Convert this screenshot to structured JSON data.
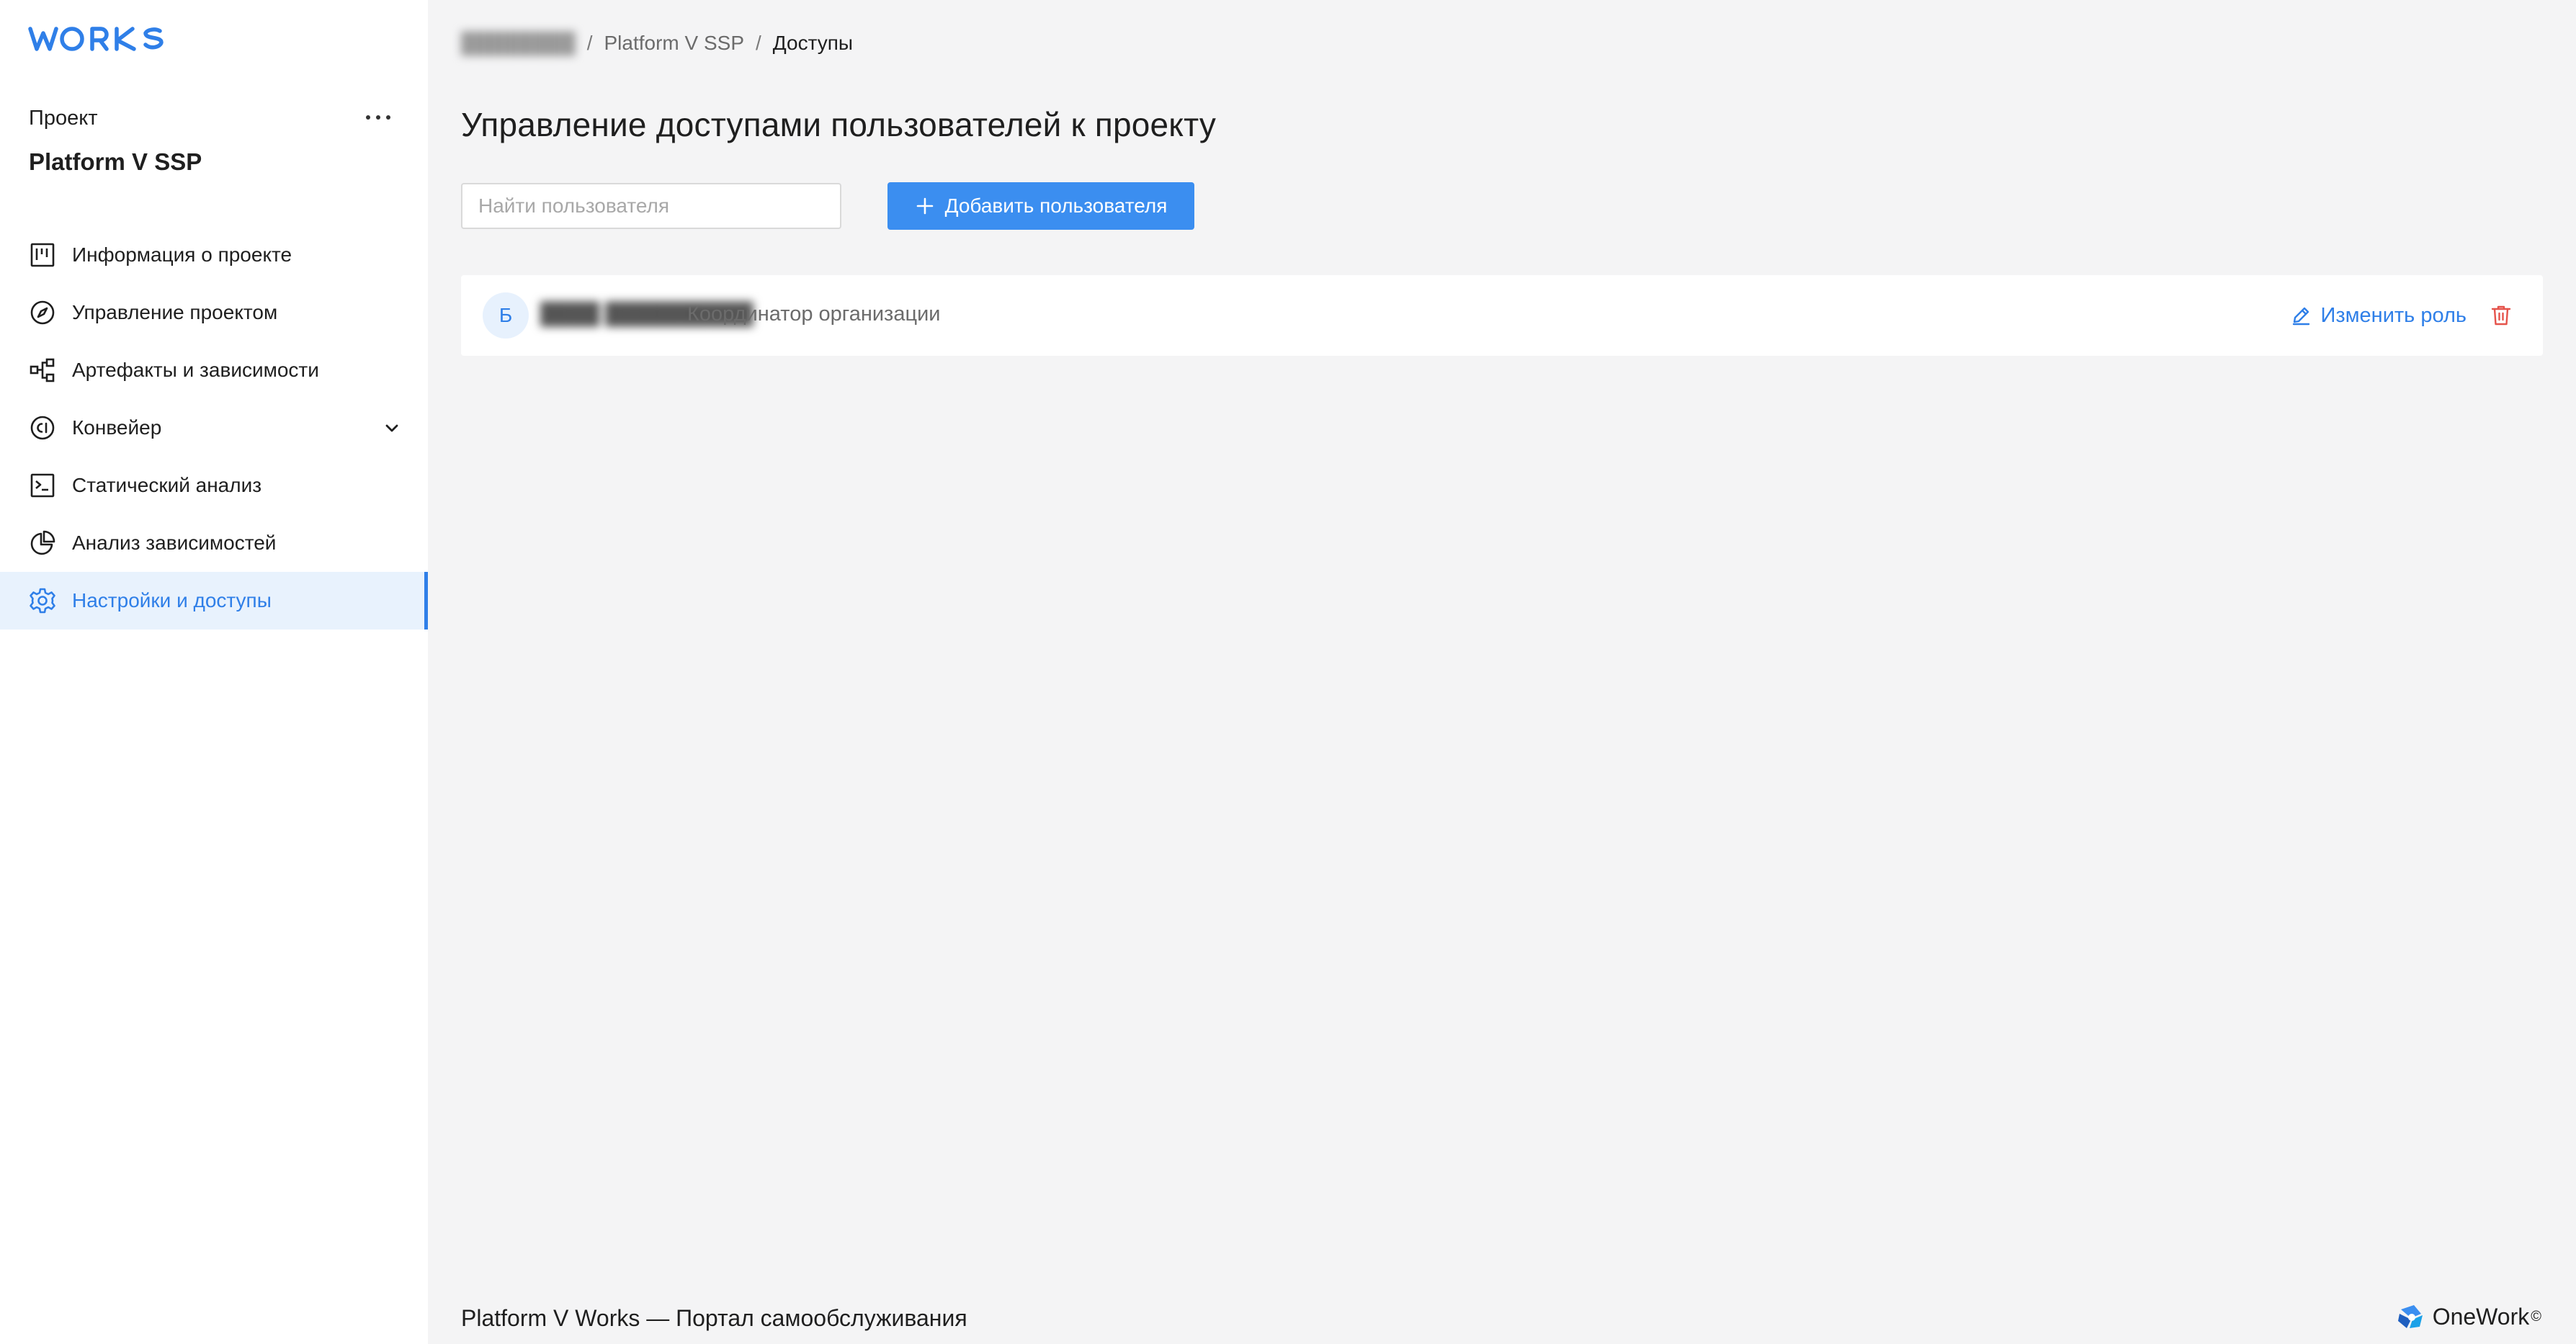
{
  "sidebar": {
    "logo_text": "WORKS",
    "project_label": "Проект",
    "project_name": "Platform V SSP",
    "nav": [
      {
        "label": "Информация о проекте",
        "icon": "kanban-board-icon"
      },
      {
        "label": "Управление проектом",
        "icon": "compass-icon"
      },
      {
        "label": "Артефакты и зависимости",
        "icon": "dependency-graph-icon"
      },
      {
        "label": "Конвейер",
        "icon": "ci-icon"
      },
      {
        "label": "Статический анализ",
        "icon": "terminal-icon"
      },
      {
        "label": "Анализ зависимостей",
        "icon": "pie-chart-icon"
      },
      {
        "label": "Настройки и доступы",
        "icon": "gear-icon",
        "active": true
      }
    ]
  },
  "breadcrumb": {
    "items": [
      "Platform V SSP",
      "Доступы"
    ]
  },
  "main": {
    "title": "Управление доступами пользователей к проекту",
    "search_placeholder": "Найти пользователя",
    "add_user_label": "Добавить пользователя"
  },
  "users": [
    {
      "avatar_letter": "Б",
      "role": "Координатор организации",
      "change_role_label": "Изменить роль"
    }
  ],
  "footer": {
    "text": "Platform V Works — Портал самообслуживания",
    "brand": "OneWork",
    "brand_mark": "©"
  },
  "colors": {
    "accent": "#3b8ef0",
    "active_bg": "#e8f2fd",
    "danger": "#e5534b",
    "background": "#f4f4f5"
  }
}
